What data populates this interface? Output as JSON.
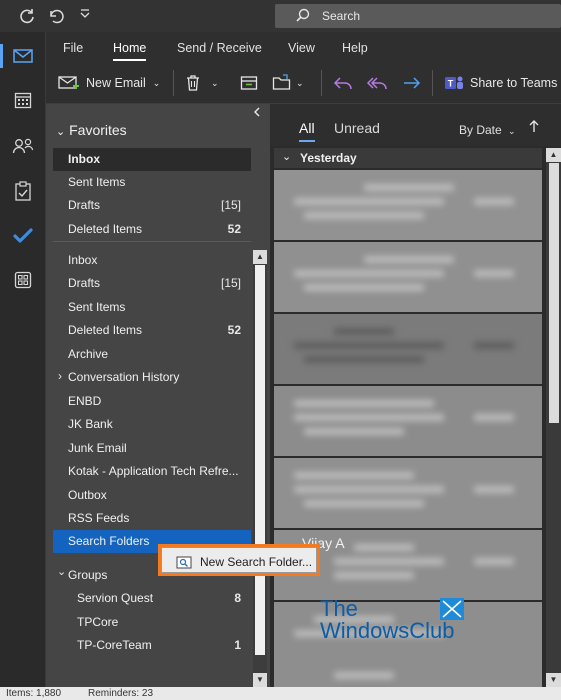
{
  "titlebar": {
    "search_placeholder": "Search",
    "icons": [
      "sync-icon",
      "undo-icon",
      "customize-quick-access-icon"
    ]
  },
  "rail": {
    "items": [
      {
        "name": "mail-icon",
        "active": true
      },
      {
        "name": "calendar-icon"
      },
      {
        "name": "people-icon"
      },
      {
        "name": "tasks-icon"
      },
      {
        "name": "todo-icon"
      },
      {
        "name": "apps-icon"
      }
    ]
  },
  "ribbon": {
    "tabs": [
      "File",
      "Home",
      "Send / Receive",
      "View",
      "Help"
    ],
    "active_tab": "Home",
    "new_email": "New Email",
    "share_to_teams": "Share to Teams"
  },
  "folders": {
    "favorites_label": "Favorites",
    "favorites": [
      {
        "label": "Inbox",
        "count": ""
      },
      {
        "label": "Sent Items",
        "count": ""
      },
      {
        "label": "Drafts",
        "count": "[15]"
      },
      {
        "label": "Deleted Items",
        "count": "52"
      }
    ],
    "mailbox": [
      {
        "label": "Inbox",
        "count": ""
      },
      {
        "label": "Drafts",
        "count": "[15]"
      },
      {
        "label": "Sent Items",
        "count": ""
      },
      {
        "label": "Deleted Items",
        "count": "52"
      },
      {
        "label": "Archive",
        "count": ""
      },
      {
        "label": "Conversation History",
        "count": ""
      },
      {
        "label": "ENBD",
        "count": ""
      },
      {
        "label": "JK Bank",
        "count": ""
      },
      {
        "label": "Junk Email",
        "count": ""
      },
      {
        "label": "Kotak - Application Tech Refre...",
        "count": ""
      },
      {
        "label": "Outbox",
        "count": ""
      },
      {
        "label": "RSS Feeds",
        "count": ""
      },
      {
        "label": "Search Folders",
        "count": ""
      }
    ],
    "groups_label": "Groups",
    "groups": [
      {
        "label": "Servion Quest",
        "count": "8"
      },
      {
        "label": "TPCore",
        "count": ""
      },
      {
        "label": "TP-CoreTeam",
        "count": "1"
      }
    ]
  },
  "context_menu": {
    "item": "New Search Folder..."
  },
  "messages": {
    "filter_all": "All",
    "filter_unread": "Unread",
    "sort_label": "By Date",
    "group_header": "Yesterday",
    "visible_sender": "Vijay A"
  },
  "watermark": {
    "line1": "The",
    "line2": "WindowsClub"
  },
  "statusbar": {
    "items": "Items: 1,880",
    "reminders": "Reminders: 23"
  }
}
